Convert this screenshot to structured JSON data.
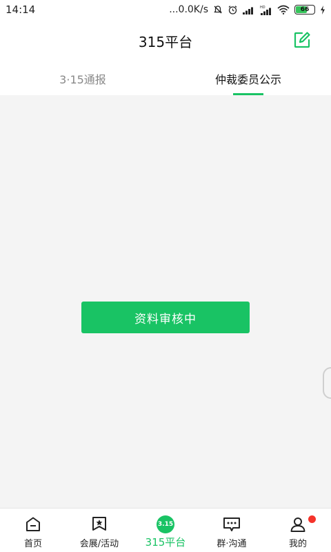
{
  "status_bar": {
    "time": "14:14",
    "network_speed": "...0.0K/s",
    "battery_level": "66",
    "battery_percent": 66,
    "icons": [
      "silent-bell-icon",
      "alarm-icon",
      "signal-icon",
      "hd-signal-icon",
      "wifi-icon",
      "battery-icon",
      "charging-icon"
    ]
  },
  "header": {
    "title": "315平台",
    "edit_icon": "edit-icon"
  },
  "tabs": [
    {
      "label": "3·15通报",
      "active": false
    },
    {
      "label": "仲裁委员公示",
      "active": true
    }
  ],
  "main": {
    "status_button_label": "资料审核中"
  },
  "bottom_nav": [
    {
      "label": "首页",
      "icon": "home-icon",
      "active": false
    },
    {
      "label": "会展/活动",
      "icon": "star-flag-icon",
      "active": false
    },
    {
      "label": "315平台",
      "icon": "315-badge-icon",
      "badge_text": "3.15",
      "active": true
    },
    {
      "label": "群·沟通",
      "icon": "chat-icon",
      "active": false
    },
    {
      "label": "我的",
      "icon": "profile-icon",
      "active": false,
      "has_notification_dot": true
    }
  ],
  "colors": {
    "accent": "#19c364",
    "background": "#f4f4f4",
    "notification": "#f5332a"
  }
}
